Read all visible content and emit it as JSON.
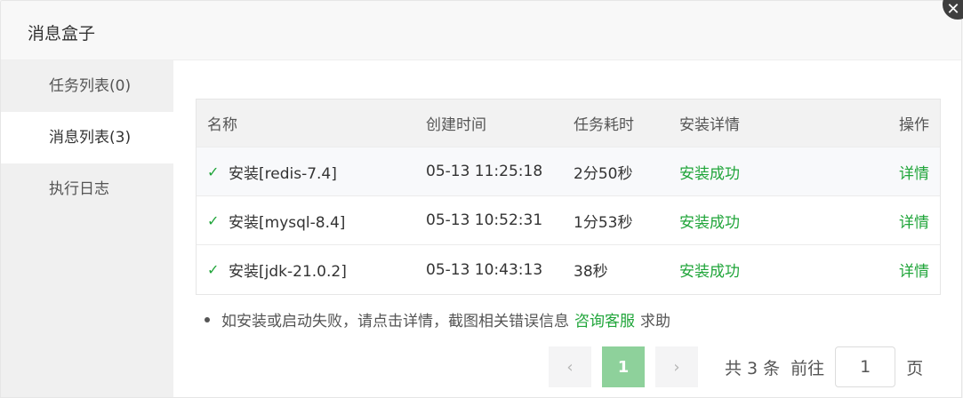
{
  "dialog": {
    "title": "消息盒子",
    "close_label": "✕"
  },
  "sidebar": {
    "items": [
      {
        "label": "任务列表(0)"
      },
      {
        "label": "消息列表(3)"
      },
      {
        "label": "执行日志"
      }
    ]
  },
  "table": {
    "headers": [
      "名称",
      "创建时间",
      "任务耗时",
      "安装详情",
      "操作"
    ],
    "rows": [
      {
        "name": "安装[redis-7.4]",
        "time": "05-13 11:25:18",
        "duration": "2分50秒",
        "status": "安装成功",
        "action": "详情"
      },
      {
        "name": "安装[mysql-8.4]",
        "time": "05-13 10:52:31",
        "duration": "1分53秒",
        "status": "安装成功",
        "action": "详情"
      },
      {
        "name": "安装[jdk-21.0.2]",
        "time": "05-13 10:43:13",
        "duration": "38秒",
        "status": "安装成功",
        "action": "详情"
      }
    ]
  },
  "tip": {
    "text": "如安装或启动失败，请点击详情，截图相关错误信息",
    "link": "咨询客服",
    "suffix": "求助"
  },
  "pagination": {
    "prev": "‹",
    "current": "1",
    "next": "›",
    "total": "共 3 条",
    "goto_label": "前往",
    "goto_value": "1",
    "page_unit": "页"
  },
  "colors": {
    "accent": "#20a53a",
    "active_page": "#8ed19b"
  }
}
